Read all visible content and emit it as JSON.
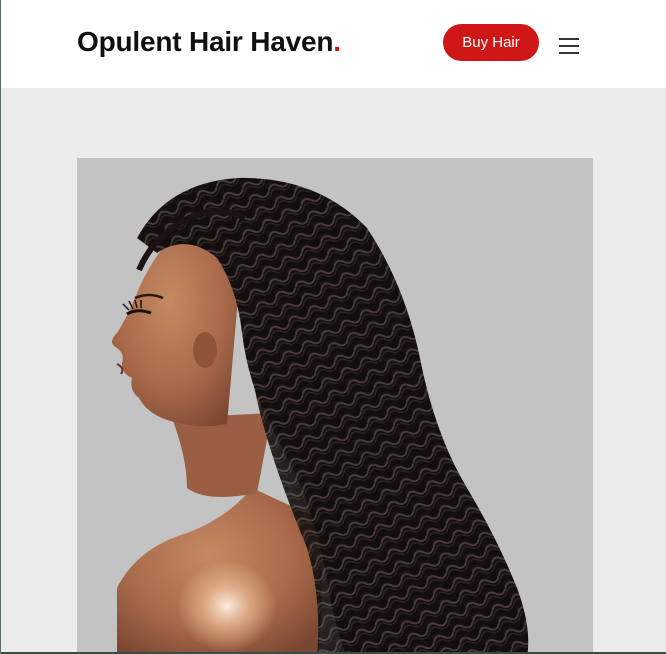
{
  "header": {
    "brand_name": "Opulent Hair Haven",
    "brand_dot": ".",
    "buy_button_label": "Buy Hair",
    "menu_icon": "hamburger-menu-icon"
  },
  "hero": {
    "image_subject": "wig-model-photo"
  },
  "colors": {
    "accent": "#cf1717",
    "header_bg": "#ffffff",
    "page_bg": "#ececec",
    "photo_bg": "#c3c3c3"
  }
}
